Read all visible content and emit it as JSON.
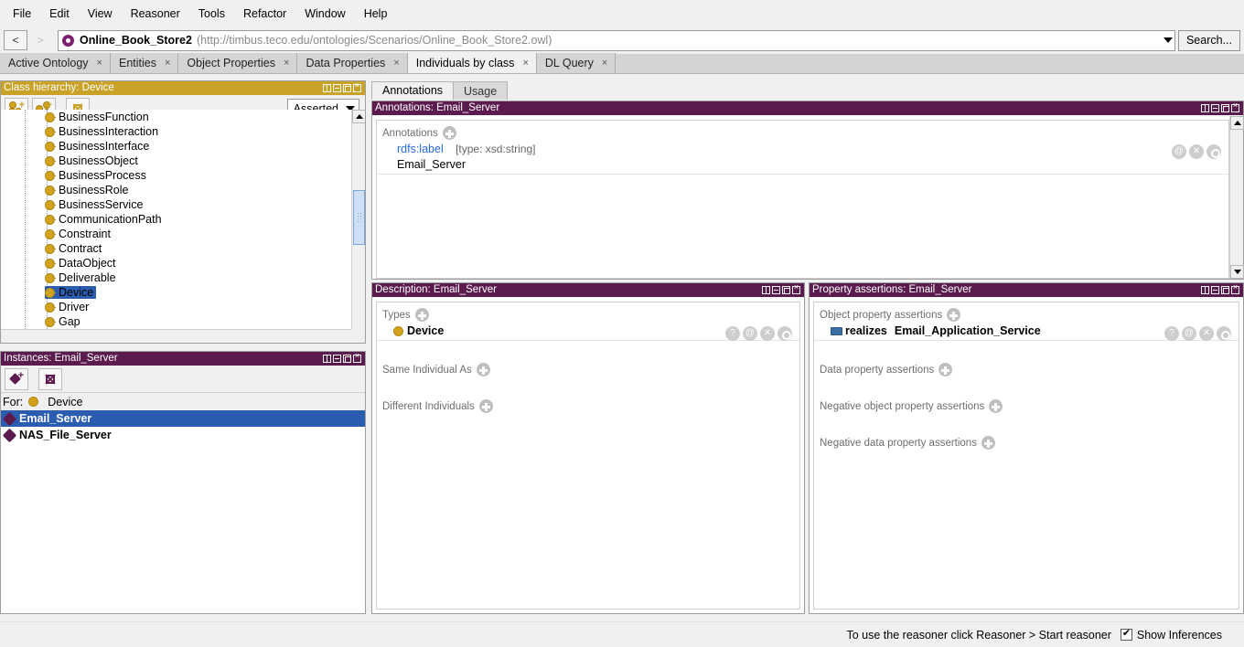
{
  "menu": {
    "items": [
      "File",
      "Edit",
      "View",
      "Reasoner",
      "Tools",
      "Refactor",
      "Window",
      "Help"
    ]
  },
  "navbar": {
    "back_label": "<",
    "forward_label": ">",
    "ontology_name": "Online_Book_Store2",
    "ontology_uri": "(http://timbus.teco.edu/ontologies/Scenarios/Online_Book_Store2.owl)",
    "ontology_icon": "ontology-icon",
    "search_label": "Search..."
  },
  "tabs": [
    {
      "label": "Active Ontology",
      "active": false,
      "close": "×"
    },
    {
      "label": "Entities",
      "active": false,
      "close": "×"
    },
    {
      "label": "Object Properties",
      "active": false,
      "close": "×"
    },
    {
      "label": "Data Properties",
      "active": false,
      "close": "×"
    },
    {
      "label": "Individuals by class",
      "active": true,
      "close": "×"
    },
    {
      "label": "DL Query",
      "active": false,
      "close": "×"
    }
  ],
  "class_hierarchy": {
    "title": "Class hierarchy: Device",
    "toolbar": {
      "add_subclass_icon": "add-subclass-icon",
      "add_sibling_icon": "add-sibling-icon",
      "delete_class_icon": "delete-class-icon",
      "reasoner_mode": "Asserted"
    },
    "nodes": [
      {
        "label": "BusinessFunction",
        "selected": false
      },
      {
        "label": "BusinessInteraction",
        "selected": false
      },
      {
        "label": "BusinessInterface",
        "selected": false
      },
      {
        "label": "BusinessObject",
        "selected": false
      },
      {
        "label": "BusinessProcess",
        "selected": false
      },
      {
        "label": "BusinessRole",
        "selected": false
      },
      {
        "label": "BusinessService",
        "selected": false
      },
      {
        "label": "CommunicationPath",
        "selected": false
      },
      {
        "label": "Constraint",
        "selected": false
      },
      {
        "label": "Contract",
        "selected": false
      },
      {
        "label": "DataObject",
        "selected": false
      },
      {
        "label": "Deliverable",
        "selected": false
      },
      {
        "label": "Device",
        "selected": true
      },
      {
        "label": "Driver",
        "selected": false
      },
      {
        "label": "Gap",
        "selected": false
      }
    ]
  },
  "instances": {
    "title": "Instances: Email_Server",
    "toolbar": {
      "add_individual_icon": "add-individual-icon",
      "delete_individual_icon": "delete-individual-icon"
    },
    "for_label": "For:",
    "for_class": "Device",
    "items": [
      {
        "label": "Email_Server",
        "selected": true
      },
      {
        "label": "NAS_File_Server",
        "selected": false
      }
    ]
  },
  "right_tabs": [
    {
      "label": "Annotations",
      "active": true
    },
    {
      "label": "Usage",
      "active": false
    }
  ],
  "annotations": {
    "title": "Annotations: Email_Server",
    "section_label": "Annotations",
    "rows": [
      {
        "property": "rdfs:label",
        "type": "[type: xsd:string]",
        "value": "Email_Server",
        "actions": [
          "at-icon",
          "delete-icon",
          "edit-icon"
        ]
      }
    ]
  },
  "description": {
    "title": "Description: Email_Server",
    "sections": [
      {
        "label": "Types",
        "items": [
          {
            "name": "Device",
            "icon": "class-icon",
            "actions": [
              "help-icon",
              "at-icon",
              "delete-icon",
              "edit-icon"
            ]
          }
        ]
      },
      {
        "label": "Same Individual As",
        "items": []
      },
      {
        "label": "Different Individuals",
        "items": []
      }
    ]
  },
  "property_assertions": {
    "title": "Property assertions: Email_Server",
    "sections": [
      {
        "label": "Object property assertions",
        "items": [
          {
            "property": "realizes",
            "value": "Email_Application_Service",
            "icon": "object-property-icon",
            "actions": [
              "help-icon",
              "at-icon",
              "delete-icon",
              "edit-icon"
            ]
          }
        ]
      },
      {
        "label": "Data property assertions",
        "items": []
      },
      {
        "label": "Negative object property assertions",
        "items": []
      },
      {
        "label": "Negative data property assertions",
        "items": []
      }
    ]
  },
  "statusbar": {
    "reasoner_hint": "To use the reasoner click Reasoner > Start reasoner",
    "show_inferences_label": "Show Inferences",
    "show_inferences_checked": true
  },
  "colors": {
    "gold_title": "#c9a227",
    "purple_title": "#5b1b4e",
    "selection_blue": "#2a5db0",
    "class_dot": "#d3a21b",
    "individual": "#5b1b4e",
    "object_property": "#3a6ea5",
    "annotation_link": "#2b6cd4"
  }
}
